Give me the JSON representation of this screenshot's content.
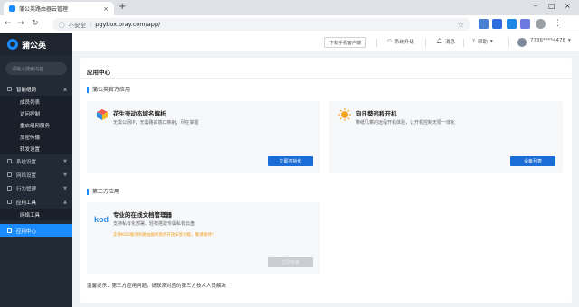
{
  "browser": {
    "tab_title": "蒲公英路由器云管理",
    "new_tab": "+",
    "security": "不安全",
    "url": "pgybox.oray.com/app/"
  },
  "sidebar": {
    "logo": "蒲公英",
    "search_placeholder": "请输入搜索内容",
    "menu": [
      {
        "label": "智能组网"
      },
      {
        "label": "系统设置"
      },
      {
        "label": "网络设置"
      },
      {
        "label": "行为管理"
      },
      {
        "label": "应用工具"
      },
      {
        "label": "应用中心"
      }
    ],
    "submenu_network": [
      "成员列表",
      "访问控制",
      "重启组网服务",
      "加密传输",
      "转发设置"
    ],
    "submenu_tools": [
      "网络工具"
    ]
  },
  "topbar": {
    "download": "下载手机客户端",
    "upgrade": "系统升级",
    "messages": "消息",
    "help": "帮助",
    "account": "7736****4478"
  },
  "main": {
    "title": "应用中心",
    "official_section": "蒲公英官方应用",
    "third_section": "第三方应用",
    "cards": [
      {
        "title": "花生壳动态域名解析",
        "desc": "无需公网IP、无需路由端口映射，尽在掌握",
        "button": "立即初始化"
      },
      {
        "title": "向日葵远程开机",
        "desc": "带纸几乘的远程开机体验，让开机控制无限一体化",
        "button": "设备列表"
      },
      {
        "title": "专业的在线文档管理器",
        "desc": "支持私有化部署、轻松搭建专属私有云盘",
        "note": "支持KOD服务的路由器将逐步开放安装功能，敬请期待！",
        "button": "立即安装",
        "logo": "kod"
      }
    ],
    "footer_tip": "温馨提示：第三方应用问题，请联系对应的第三方技术人员解决"
  }
}
